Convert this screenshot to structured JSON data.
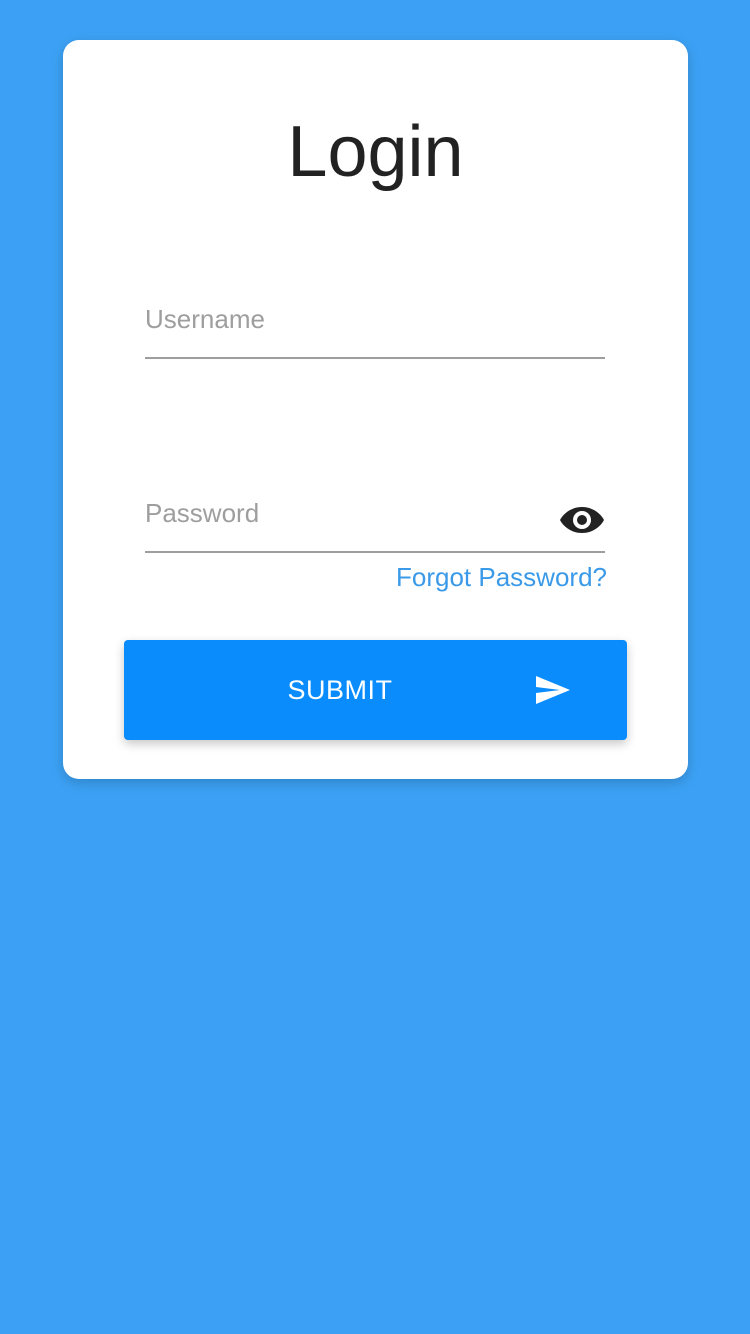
{
  "login": {
    "title": "Login",
    "username": {
      "placeholder": "Username",
      "value": ""
    },
    "password": {
      "placeholder": "Password",
      "value": "",
      "toggle_icon": "eye-icon"
    },
    "forgot_password_label": "Forgot Password?",
    "submit_label": "SUBMIT",
    "submit_icon": "send-icon"
  },
  "colors": {
    "background": "#3ca1f4",
    "card": "#ffffff",
    "accent": "#0a8cfc",
    "link": "#3b9ae8"
  }
}
